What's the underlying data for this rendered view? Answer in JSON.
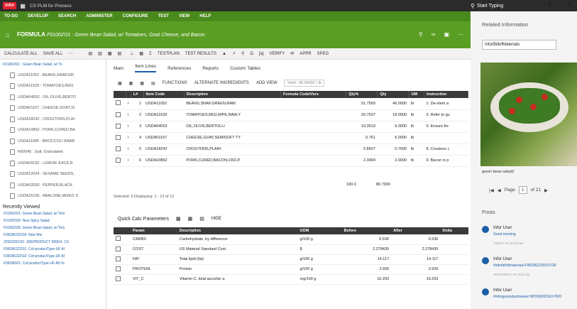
{
  "topbar": {
    "logo": "infor",
    "app_title": "CS PLM for Process",
    "search_placeholder": "Start Typing"
  },
  "menu": [
    "TO-DO",
    "DEVELOP",
    "SEARCH",
    "ADMINISTER",
    "CONFIGURE",
    "TEST",
    "VIEW",
    "HELP"
  ],
  "formula": {
    "label": "FORMULA",
    "name": "F01002\\01 : Green Bean Salad, w/ Tomatoes, Goat Cheese, and Bacon"
  },
  "toolbar": {
    "calc_all": "CALCULATE ALL",
    "save_all": "SAVE ALL",
    "functions": "FUNCTIONS",
    "testplan": "TESTPLAN",
    "testresults": "TEST RESULTS",
    "verify": "VERIFY",
    "appr": "APPR",
    "speg": "SPEG"
  },
  "tree": {
    "root": "F01002\\01 : Green Bean Salad, w/ To",
    "items": [
      "USDA11052 : BEANS,SNAP,GR",
      "USDA11529 : TOMATOES,RED,",
      "USDA04053 : OIL,OLIVE,BERTO",
      "USDA01157 : CHEESE,GOAT,SI",
      "USDA18242 : CROUTONS,PLAI",
      "USDA10862 : PORK,CURED,BA",
      "USDA11095 : BROCCOLI RAAB",
      "R00045 : Salt, Granulated",
      "USDA09152 : LEMON JUICE,R",
      "USDA12024 : SESAME SEEDS,",
      "USDA02030 : PEPPER,BLACK",
      "USDA15156 : ABALONE,MIXED S"
    ]
  },
  "recent": {
    "title": "Recently Viewed",
    "items": [
      "F01002\\01: Green Bean Salad, w/ Tom",
      "F01002\\06: New Spicy Salad",
      "F01002\\05: Green Bean Salad, w/ Tom",
      "F08186222\\03: New Mix",
      "22922261\\01: JDEPRODUCT 999G4, CU",
      "F08186222\\01: Cof-productType-UF Al",
      "F08186222\\02: Cof-productType-UF Al",
      "F08186\\01: Cof-productType-UF AD fo"
    ]
  },
  "tabs": [
    "Main",
    "Item Lines",
    "References",
    "Reports",
    "Custom Tables"
  ],
  "subtoolbar": {
    "functions": "FUNCTIONS",
    "alt": "ALTERNATE INGREDIENTS",
    "addview": "ADD VIEW",
    "yield": "Yield : 96.94092 / lb"
  },
  "grid": {
    "headers": [
      "",
      "",
      "L#",
      "Item Code",
      "Description",
      "Formula Code\\Vers",
      "Qty%",
      "Qty",
      "UM",
      "Instruction"
    ],
    "rows": [
      [
        "1",
        "USDA11052",
        "BEANS,SNAP,GREEN,RAW",
        "",
        "51.7569",
        "46.0000",
        "lb",
        "1. De-stem a"
      ],
      [
        "2",
        "USDA11529",
        "TOMATOES,RED,RIPE,RAW,Y",
        "",
        "20.7537",
        "18.0000",
        "lb",
        "3. Refer to gu"
      ],
      [
        "3",
        "USDA04053",
        "OIL,OLIVE,BERTOLLI",
        "",
        "10.3519",
        "9.0000",
        "lb",
        "5. Ensure fre"
      ],
      [
        "4",
        "USDA01157",
        "CHEESE,GOAT,SEMISOFT TY",
        "",
        "5.761",
        "5.0000",
        "lb",
        ""
      ],
      [
        "5",
        "USDA18242",
        "CROUTONS,PLAIN",
        "",
        "0.8627",
        "0.7500",
        "lb",
        "8. Croutons c"
      ],
      [
        "6",
        "USDA10862",
        "PORK,CURED,BACON,CKD,P",
        "",
        "2.3004",
        "2.0000",
        "lb",
        "9. Bacon is p"
      ]
    ],
    "totals": {
      "qtypct": "100.0",
      "qty": "86.7000"
    }
  },
  "selection": "Selected: 0   Displaying: 1 - 12 of 12",
  "quick": {
    "title": "Quick Calc Parameters",
    "hide": "HIDE",
    "headers": [
      "",
      "Param",
      "Description",
      "UOM",
      "Before",
      "After",
      "Delta"
    ],
    "rows": [
      [
        "CARBS",
        "Carbohydrate, by difference",
        "g/100 g",
        "6.536",
        "6.536",
        ""
      ],
      [
        "COST",
        "US Material Standard Cost",
        "$",
        "2.278430",
        "2.278430",
        ""
      ],
      [
        "FAT",
        "Total lipid (fat)",
        "g/100 g",
        "14.117",
        "14.117",
        ""
      ],
      [
        "PROTEIN",
        "Protein",
        "g/100 g",
        "3.926",
        "3.926",
        ""
      ],
      [
        "VIT_C",
        "Vitamin C, total ascorbic a",
        "mg/100 g",
        "10.293",
        "10.293",
        ""
      ]
    ]
  },
  "right": {
    "title": "Related Information",
    "select": "InforBillofMaterials",
    "caption": "green bean salad2",
    "page_label": "Page",
    "page_value": "1",
    "page_total": "of 21",
    "posts_title": "Posts",
    "posts": [
      {
        "name": "Infor User",
        "text": "Good morning",
        "time": "TODAY AT 10:04 AM"
      },
      {
        "name": "Infor User",
        "text": "#inforbillofmaterials:F08186222\\03:FOR",
        "time": "YESTERDAY AT 9:34 AM"
      },
      {
        "name": "Infor User",
        "text": "#inforgeproductmaster:NPD00000163 PRO",
        "time": ""
      }
    ]
  }
}
